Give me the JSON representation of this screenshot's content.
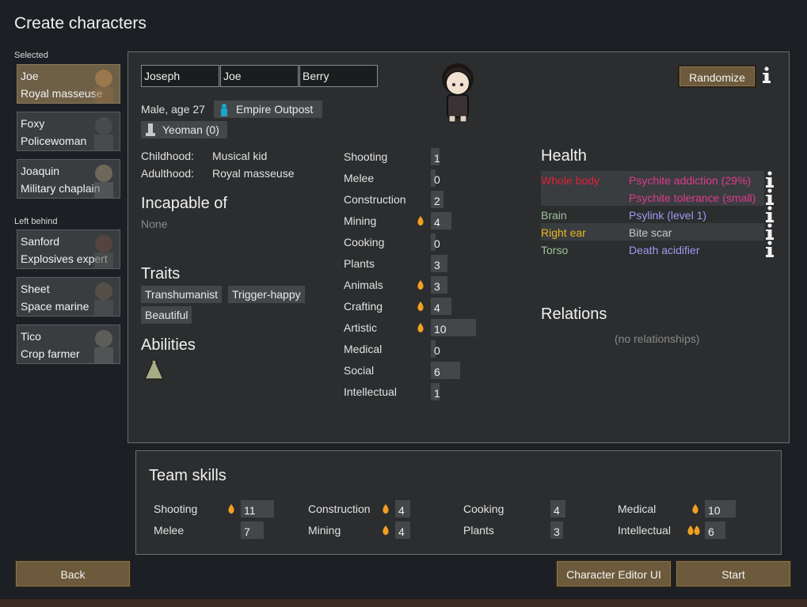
{
  "page_title": "Create characters",
  "left": {
    "selected_label": "Selected",
    "left_behind_label": "Left behind",
    "selected": [
      {
        "name": "Joe",
        "title": "Royal masseuse"
      },
      {
        "name": "Foxy",
        "title": "Policewoman"
      },
      {
        "name": "Joaquin",
        "title": "Military chaplain"
      }
    ],
    "left_behind": [
      {
        "name": "Sanford",
        "title": "Explosives expert"
      },
      {
        "name": "Sheet",
        "title": "Space marine"
      },
      {
        "name": "Tico",
        "title": "Crop farmer"
      }
    ]
  },
  "names": {
    "first": "Joseph",
    "nick": "Joe",
    "last": "Berry"
  },
  "randomize_label": "Randomize",
  "bio": {
    "gender_age": "Male, age 27",
    "faction": "Empire Outpost",
    "royal_title": "Yeoman (0)",
    "childhood_label": "Childhood:",
    "childhood": "Musical kid",
    "adulthood_label": "Adulthood:",
    "adulthood": "Royal masseuse"
  },
  "incapable": {
    "heading": "Incapable of",
    "value": "None"
  },
  "traits": {
    "heading": "Traits",
    "items": [
      "Transhumanist",
      "Trigger-happy",
      "Beautiful"
    ]
  },
  "abilities": {
    "heading": "Abilities"
  },
  "skills": [
    {
      "name": "Shooting",
      "value": "1",
      "level": 1,
      "passion": 0
    },
    {
      "name": "Melee",
      "value": "0",
      "level": 0,
      "passion": 0
    },
    {
      "name": "Construction",
      "value": "2",
      "level": 2,
      "passion": 0
    },
    {
      "name": "Mining",
      "value": "4",
      "level": 4,
      "passion": 1
    },
    {
      "name": "Cooking",
      "value": "0",
      "level": 0,
      "passion": 0
    },
    {
      "name": "Plants",
      "value": "3",
      "level": 3,
      "passion": 0
    },
    {
      "name": "Animals",
      "value": "3",
      "level": 3,
      "passion": 1
    },
    {
      "name": "Crafting",
      "value": "4",
      "level": 4,
      "passion": 1
    },
    {
      "name": "Artistic",
      "value": "10",
      "level": 10,
      "passion": 1
    },
    {
      "name": "Medical",
      "value": "0",
      "level": 0,
      "passion": 0
    },
    {
      "name": "Social",
      "value": "6",
      "level": 6,
      "passion": 0
    },
    {
      "name": "Intellectual",
      "value": "1",
      "level": 1,
      "passion": 0
    }
  ],
  "health": {
    "heading": "Health",
    "rows": [
      {
        "part": "Whole body",
        "part_color": "#e0203a",
        "condition": "Psychite addiction (29%)",
        "cond_color": "#e03a8c"
      },
      {
        "part": "",
        "part_color": "#e0203a",
        "condition": "Psychite tolerance (small)",
        "cond_color": "#e03a8c"
      },
      {
        "part": "Brain",
        "part_color": "#9ec29a",
        "condition": "Psylink (level 1)",
        "cond_color": "#9e9cf0"
      },
      {
        "part": "Right ear",
        "part_color": "#e8b81e",
        "condition": "Bite scar",
        "cond_color": "#c8c8c8"
      },
      {
        "part": "Torso",
        "part_color": "#9ec29a",
        "condition": "Death acidifier",
        "cond_color": "#9e9cf0"
      }
    ]
  },
  "relations": {
    "heading": "Relations",
    "empty": "(no relationships)"
  },
  "team_skills": {
    "heading": "Team skills",
    "items": [
      {
        "name": "Shooting",
        "value": "11",
        "level": 11,
        "passion": 1
      },
      {
        "name": "Melee",
        "value": "7",
        "level": 7,
        "passion": 0
      },
      {
        "name": "Construction",
        "value": "4",
        "level": 4,
        "passion": 1
      },
      {
        "name": "Mining",
        "value": "4",
        "level": 4,
        "passion": 1
      },
      {
        "name": "Cooking",
        "value": "4",
        "level": 4,
        "passion": 0
      },
      {
        "name": "Plants",
        "value": "3",
        "level": 3,
        "passion": 0
      },
      {
        "name": "Medical",
        "value": "10",
        "level": 10,
        "passion": 1
      },
      {
        "name": "Intellectual",
        "value": "6",
        "level": 6,
        "passion": 2
      }
    ]
  },
  "buttons": {
    "back": "Back",
    "editor": "Character Editor UI",
    "start": "Start"
  },
  "colors": {
    "button": "#6d5a3c",
    "selected_pawn": "#6e6047",
    "flame": "#f0a020",
    "faction_icon": "#1aa6c8"
  },
  "icons": [
    "info-icon",
    "flame-icon",
    "faction-icon",
    "royal-title-icon",
    "psycast-ability-icon"
  ]
}
